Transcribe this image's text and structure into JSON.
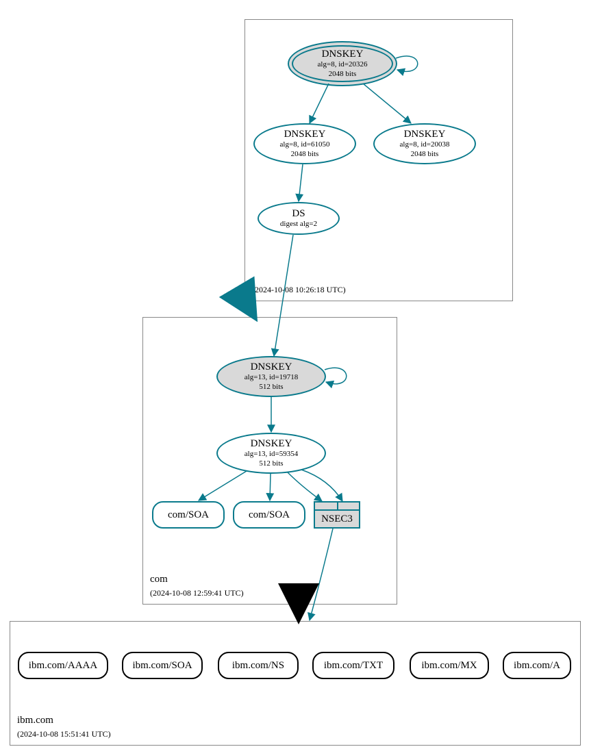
{
  "zones": {
    "root": {
      "name": ".",
      "timestamp": "(2024-10-08 10:26:18 UTC)"
    },
    "com": {
      "name": "com",
      "timestamp": "(2024-10-08 12:59:41 UTC)"
    },
    "ibm": {
      "name": "ibm.com",
      "timestamp": "(2024-10-08 15:51:41 UTC)"
    }
  },
  "nodes": {
    "root_ksk": {
      "title": "DNSKEY",
      "line2": "alg=8, id=20326",
      "line3": "2048 bits"
    },
    "root_zsk1": {
      "title": "DNSKEY",
      "line2": "alg=8, id=61050",
      "line3": "2048 bits"
    },
    "root_zsk2": {
      "title": "DNSKEY",
      "line2": "alg=8, id=20038",
      "line3": "2048 bits"
    },
    "root_ds": {
      "title": "DS",
      "line2": "digest alg=2"
    },
    "com_ksk": {
      "title": "DNSKEY",
      "line2": "alg=13, id=19718",
      "line3": "512 bits"
    },
    "com_zsk": {
      "title": "DNSKEY",
      "line2": "alg=13, id=59354",
      "line3": "512 bits"
    },
    "com_soa1": "com/SOA",
    "com_soa2": "com/SOA",
    "nsec3": "NSEC3",
    "ibm_aaaa": "ibm.com/AAAA",
    "ibm_soa": "ibm.com/SOA",
    "ibm_ns": "ibm.com/NS",
    "ibm_txt": "ibm.com/TXT",
    "ibm_mx": "ibm.com/MX",
    "ibm_a": "ibm.com/A"
  },
  "colors": {
    "teal": "#0a7a8c",
    "black": "#000000",
    "fill_grey": "#d9d9d9"
  }
}
